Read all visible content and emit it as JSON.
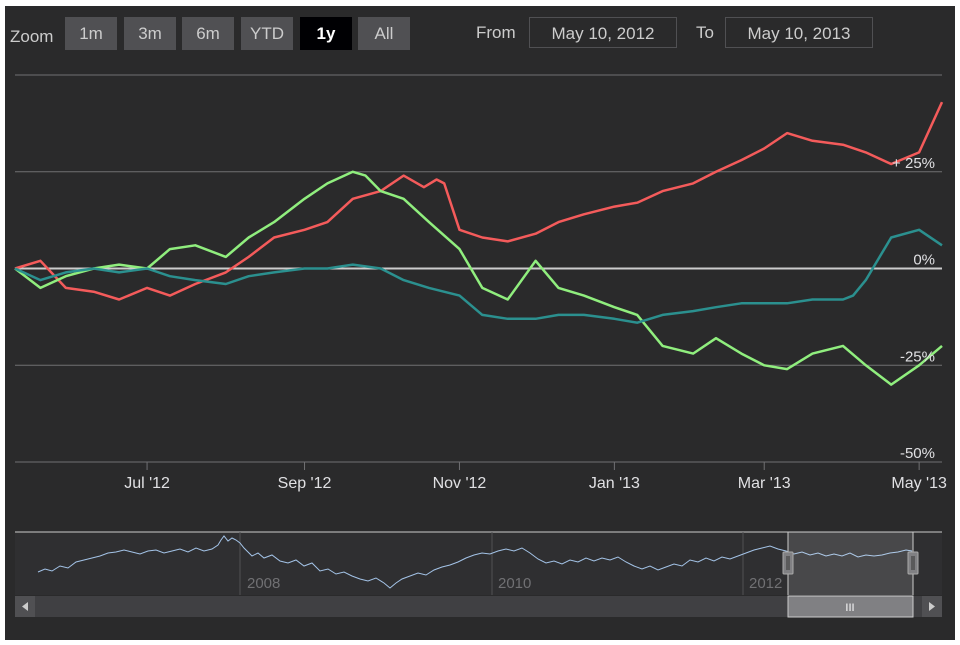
{
  "range_selector": {
    "zoom_label": "Zoom",
    "buttons": [
      {
        "label": "1m",
        "selected": false
      },
      {
        "label": "3m",
        "selected": false
      },
      {
        "label": "6m",
        "selected": false
      },
      {
        "label": "YTD",
        "selected": false
      },
      {
        "label": "1y",
        "selected": true
      },
      {
        "label": "All",
        "selected": false
      }
    ],
    "from_label": "From",
    "from_value": "May 10, 2012",
    "to_label": "To",
    "to_value": "May 10, 2013"
  },
  "navigator": {
    "year_labels": [
      "2008",
      "2010",
      "2012"
    ],
    "scrollbar_grip": "III",
    "line_color": "#a4c4e8"
  },
  "chart_data": {
    "type": "line",
    "title": "",
    "xlabel": "",
    "ylabel": "",
    "x_tick_labels": [
      "Jul '12",
      "Sep '12",
      "Nov '12",
      "Jan '13",
      "Mar '13",
      "May '13"
    ],
    "x_tick_dates": [
      "2012-07-01",
      "2012-09-01",
      "2012-11-01",
      "2013-01-01",
      "2013-03-01",
      "2013-05-01"
    ],
    "x_range": [
      "2012-05-10",
      "2013-05-10"
    ],
    "y_tick_labels": [
      "+ 25%",
      "0%",
      "-25%",
      "-50%"
    ],
    "y_ticks": [
      25,
      0,
      -25,
      -50
    ],
    "ylim": [
      -50,
      50
    ],
    "grid": true,
    "series": [
      {
        "color": "#f45b5b",
        "x": [
          "2012-05-10",
          "2012-05-20",
          "2012-05-30",
          "2012-06-10",
          "2012-06-20",
          "2012-07-01",
          "2012-07-10",
          "2012-07-20",
          "2012-08-01",
          "2012-08-10",
          "2012-08-20",
          "2012-09-01",
          "2012-09-10",
          "2012-09-20",
          "2012-10-01",
          "2012-10-10",
          "2012-10-18",
          "2012-10-23",
          "2012-10-26",
          "2012-11-01",
          "2012-11-10",
          "2012-11-20",
          "2012-12-01",
          "2012-12-10",
          "2012-12-20",
          "2013-01-01",
          "2013-01-10",
          "2013-01-20",
          "2013-02-01",
          "2013-02-10",
          "2013-02-20",
          "2013-03-01",
          "2013-03-10",
          "2013-03-20",
          "2013-04-01",
          "2013-04-10",
          "2013-04-20",
          "2013-05-01",
          "2013-05-10"
        ],
        "values": [
          0,
          2,
          -5,
          -6,
          -8,
          -5,
          -7,
          -4,
          -1,
          3,
          8,
          10,
          12,
          18,
          20,
          24,
          21,
          23,
          22,
          10,
          8,
          7,
          9,
          12,
          14,
          16,
          17,
          20,
          22,
          25,
          28,
          31,
          35,
          33,
          32,
          30,
          27,
          30,
          43
        ]
      },
      {
        "color": "#90ee7e",
        "x": [
          "2012-05-10",
          "2012-05-20",
          "2012-05-30",
          "2012-06-10",
          "2012-06-20",
          "2012-07-01",
          "2012-07-10",
          "2012-07-20",
          "2012-08-01",
          "2012-08-10",
          "2012-08-20",
          "2012-09-01",
          "2012-09-10",
          "2012-09-20",
          "2012-09-25",
          "2012-10-01",
          "2012-10-10",
          "2012-10-20",
          "2012-11-01",
          "2012-11-10",
          "2012-11-20",
          "2012-12-01",
          "2012-12-10",
          "2012-12-20",
          "2013-01-01",
          "2013-01-10",
          "2013-01-20",
          "2013-02-01",
          "2013-02-10",
          "2013-02-20",
          "2013-03-01",
          "2013-03-10",
          "2013-03-20",
          "2013-04-01",
          "2013-04-10",
          "2013-04-20",
          "2013-05-01",
          "2013-05-10"
        ],
        "values": [
          0,
          -5,
          -2,
          0,
          1,
          0,
          5,
          6,
          3,
          8,
          12,
          18,
          22,
          25,
          24,
          20,
          18,
          12,
          5,
          -5,
          -8,
          2,
          -5,
          -7,
          -10,
          -12,
          -20,
          -22,
          -18,
          -22,
          -25,
          -26,
          -22,
          -20,
          -25,
          -30,
          -25,
          -20
        ]
      },
      {
        "color": "#2b908f",
        "x": [
          "2012-05-10",
          "2012-05-20",
          "2012-05-30",
          "2012-06-10",
          "2012-06-20",
          "2012-07-01",
          "2012-07-10",
          "2012-07-20",
          "2012-08-01",
          "2012-08-10",
          "2012-08-20",
          "2012-09-01",
          "2012-09-10",
          "2012-09-20",
          "2012-10-01",
          "2012-10-10",
          "2012-10-20",
          "2012-11-01",
          "2012-11-10",
          "2012-11-20",
          "2012-12-01",
          "2012-12-10",
          "2012-12-20",
          "2013-01-01",
          "2013-01-10",
          "2013-01-20",
          "2013-02-01",
          "2013-02-10",
          "2013-02-20",
          "2013-03-01",
          "2013-03-10",
          "2013-03-20",
          "2013-04-01",
          "2013-04-05",
          "2013-04-10",
          "2013-04-20",
          "2013-05-01",
          "2013-05-10"
        ],
        "values": [
          0,
          -3,
          -1,
          0,
          -1,
          0,
          -2,
          -3,
          -4,
          -2,
          -1,
          0,
          0,
          1,
          0,
          -3,
          -5,
          -7,
          -12,
          -13,
          -13,
          -12,
          -12,
          -13,
          -14,
          -12,
          -11,
          -10,
          -9,
          -9,
          -9,
          -8,
          -8,
          -7,
          -3,
          8,
          10,
          6
        ]
      }
    ]
  }
}
